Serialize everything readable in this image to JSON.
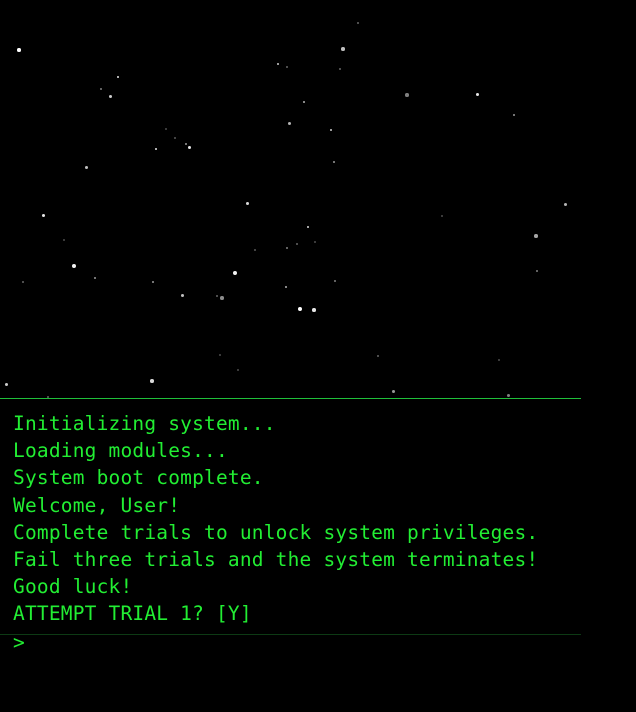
{
  "terminal": {
    "lines": [
      "Initializing system...",
      "Loading modules...",
      "System boot complete.",
      "Welcome, User!",
      "Complete trials to unlock system privileges.",
      "Fail three trials and the system terminates!",
      "Good luck!",
      "ATTEMPT TRIAL 1? [Y]"
    ],
    "prompt_symbol": ">",
    "input_value": ""
  },
  "colors": {
    "text": "#22ee33",
    "background": "#000000",
    "divider": "#1fbf3a"
  }
}
